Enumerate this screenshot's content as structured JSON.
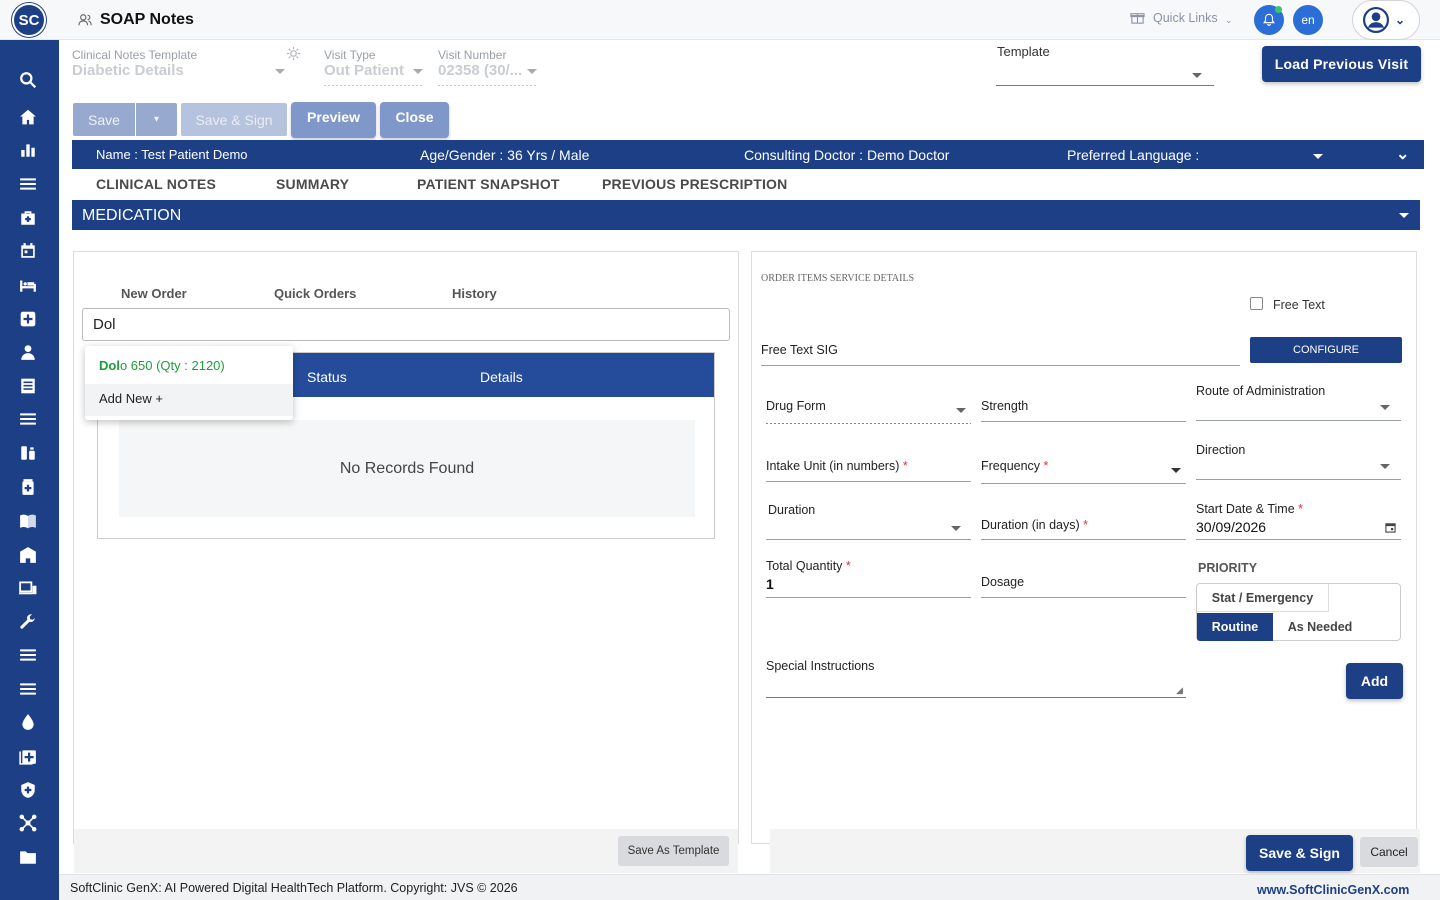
{
  "app": {
    "logo": "SC",
    "title": "SOAP Notes"
  },
  "topbar": {
    "quick_links": "Quick Links",
    "language": "en",
    "icons": [
      "users-icon",
      "gift-icon",
      "bell-icon",
      "user-avatar-icon"
    ]
  },
  "header_fields": {
    "clinical_template_label": "Clinical Notes Template",
    "clinical_template_value": "Diabetic Details",
    "visit_type_label": "Visit Type",
    "visit_type_value": "Out Patient",
    "visit_number_label": "Visit Number",
    "visit_number_value": "02358 (30/...",
    "template_label": "Template",
    "load_previous": "Load Previous Visit"
  },
  "actions": {
    "save": "Save",
    "save_sign": "Save & Sign",
    "preview": "Preview",
    "close": "Close"
  },
  "patient": {
    "name_label": "Name :",
    "name": "Test Patient Demo",
    "agegender_label": "Age/Gender :",
    "agegender": "36 Yrs / Male",
    "doctor_label": "Consulting Doctor :",
    "doctor": "Demo Doctor",
    "language_label": "Preferred Language :"
  },
  "tabs": [
    "CLINICAL NOTES",
    "SUMMARY",
    "PATIENT SNAPSHOT",
    "PREVIOUS PRESCRIPTION"
  ],
  "section": {
    "title": "MEDICATION"
  },
  "left_panel": {
    "subtabs": [
      "New Order",
      "Quick Orders",
      "History"
    ],
    "search_value": "Dol",
    "table_headers": [
      "Status",
      "Details"
    ],
    "empty": "No Records Found",
    "dropdown": {
      "match": "Dol",
      "rest": "o 650 (Qty : 2120)",
      "add_new": "Add New +"
    },
    "save_template": "Save As Template"
  },
  "right_panel": {
    "heading": "ORDER ITEMS SERVICE DETAILS",
    "free_text": "Free Text",
    "free_text_sig": "Free Text SIG",
    "configure": "CONFIGURE",
    "drug_form": "Drug Form",
    "strength": "Strength",
    "route": "Route of Administration",
    "intake_unit": "Intake Unit (in numbers)",
    "frequency": "Frequency",
    "direction": "Direction",
    "duration": "Duration",
    "duration_days": "Duration (in days)",
    "start_date_label": "Start Date & Time",
    "start_date": "30/09/2026",
    "total_qty_label": "Total Quantity",
    "total_qty": "1",
    "dosage": "Dosage",
    "priority_label": "PRIORITY",
    "priority_options": [
      "Stat / Emergency",
      "Routine",
      "As Needed"
    ],
    "priority_selected": "Routine",
    "special_instructions": "Special Instructions",
    "add": "Add",
    "save_sign": "Save & Sign",
    "cancel": "Cancel"
  },
  "footer": {
    "copyright": "SoftClinic GenX: AI Powered Digital HealthTech Platform. Copyright: JVS © 2026",
    "website": "www.SoftClinicGenX.com"
  },
  "colors": {
    "primary": "#1d3f86",
    "accent_green": "#1f9d3a",
    "muted_button": "#98a9cf"
  }
}
